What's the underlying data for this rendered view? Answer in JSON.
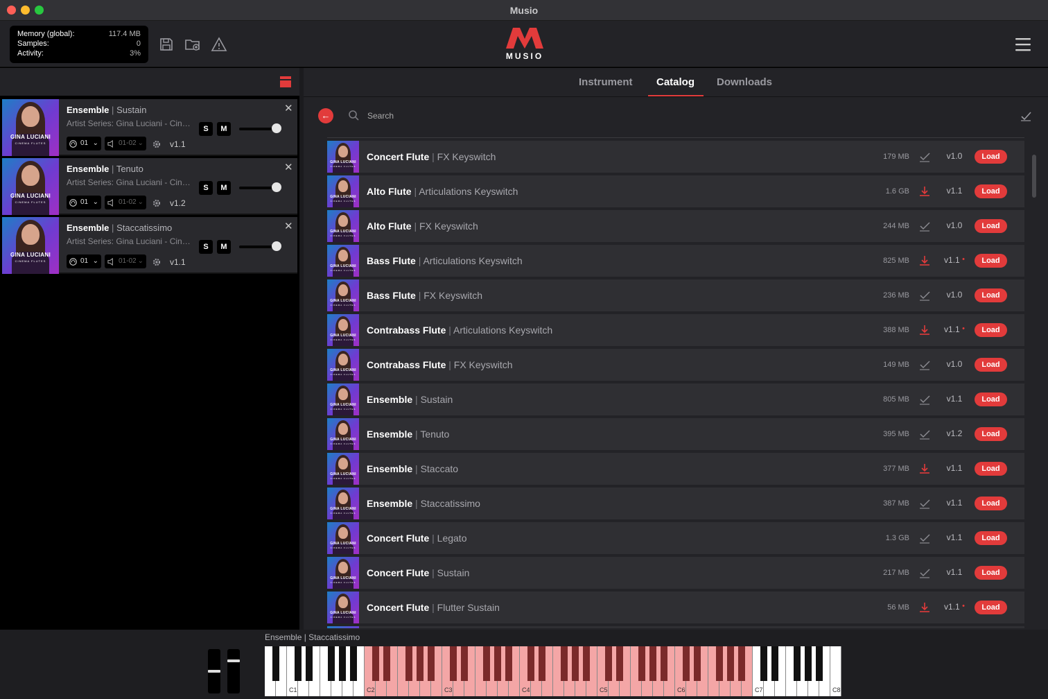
{
  "window": {
    "title": "Musio"
  },
  "stats": [
    {
      "label": "Memory (global):",
      "value": "117.4 MB"
    },
    {
      "label": "Samples:",
      "value": "0"
    },
    {
      "label": "Activity:",
      "value": "3%"
    }
  ],
  "brand": {
    "logo_text": "MUSIO",
    "accent": "#e23b3b"
  },
  "tabs": [
    {
      "label": "Instrument"
    },
    {
      "label": "Catalog"
    },
    {
      "label": "Downloads"
    }
  ],
  "active_tab": "Catalog",
  "search": {
    "placeholder": "Search"
  },
  "slots": [
    {
      "name": "Ensemble",
      "articulation": "Sustain",
      "artist": "Artist Series: Gina Luciani - Cinema Flutes",
      "channel": "01",
      "output": "01-02",
      "version": "v1.1",
      "volume": 0.9,
      "thumb_brand": "GINA LUCIANI",
      "thumb_sub": "CINEMA FLUTES"
    },
    {
      "name": "Ensemble",
      "articulation": "Tenuto",
      "artist": "Artist Series: Gina Luciani - Cinema Flutes",
      "channel": "01",
      "output": "01-02",
      "version": "v1.2",
      "volume": 0.9,
      "thumb_brand": "GINA LUCIANI",
      "thumb_sub": "CINEMA FLUTES"
    },
    {
      "name": "Ensemble",
      "articulation": "Staccatissimo",
      "artist": "Artist Series: Gina Luciani - Cinema Flutes",
      "channel": "01",
      "output": "01-02",
      "version": "v1.1",
      "volume": 0.9,
      "thumb_brand": "GINA LUCIANI",
      "thumb_sub": "CINEMA FLUTES"
    }
  ],
  "slot_buttons": {
    "solo": "S",
    "mute": "M"
  },
  "catalog": [
    {
      "name": "Concert Flute",
      "articulation": "FX Keyswitch",
      "size": "179 MB",
      "status": "installed",
      "version": "v1.0",
      "update": false
    },
    {
      "name": "Alto Flute",
      "articulation": "Articulations Keyswitch",
      "size": "1.6 GB",
      "status": "download",
      "version": "v1.1",
      "update": false
    },
    {
      "name": "Alto Flute",
      "articulation": "FX Keyswitch",
      "size": "244 MB",
      "status": "installed",
      "version": "v1.0",
      "update": false
    },
    {
      "name": "Bass Flute",
      "articulation": "Articulations Keyswitch",
      "size": "825 MB",
      "status": "download",
      "version": "v1.1",
      "update": true
    },
    {
      "name": "Bass Flute",
      "articulation": "FX Keyswitch",
      "size": "236 MB",
      "status": "installed",
      "version": "v1.0",
      "update": false
    },
    {
      "name": "Contrabass Flute",
      "articulation": "Articulations Keyswitch",
      "size": "388 MB",
      "status": "download",
      "version": "v1.1",
      "update": true
    },
    {
      "name": "Contrabass Flute",
      "articulation": "FX Keyswitch",
      "size": "149 MB",
      "status": "installed",
      "version": "v1.0",
      "update": false
    },
    {
      "name": "Ensemble",
      "articulation": "Sustain",
      "size": "805 MB",
      "status": "installed",
      "version": "v1.1",
      "update": false
    },
    {
      "name": "Ensemble",
      "articulation": "Tenuto",
      "size": "395 MB",
      "status": "installed",
      "version": "v1.2",
      "update": false
    },
    {
      "name": "Ensemble",
      "articulation": "Staccato",
      "size": "377 MB",
      "status": "download",
      "version": "v1.1",
      "update": false
    },
    {
      "name": "Ensemble",
      "articulation": "Staccatissimo",
      "size": "387 MB",
      "status": "installed",
      "version": "v1.1",
      "update": false
    },
    {
      "name": "Concert Flute",
      "articulation": "Legato",
      "size": "1.3 GB",
      "status": "installed",
      "version": "v1.1",
      "update": false
    },
    {
      "name": "Concert Flute",
      "articulation": "Sustain",
      "size": "217 MB",
      "status": "installed",
      "version": "v1.1",
      "update": false
    },
    {
      "name": "Concert Flute",
      "articulation": "Flutter Sustain",
      "size": "56 MB",
      "status": "download",
      "version": "v1.1",
      "update": true
    }
  ],
  "catalog_labels": {
    "load": "Load",
    "separator": "|",
    "update_marker": "•"
  },
  "keyboard": {
    "title": "Ensemble | Staccatissimo",
    "octave_labels": [
      "C1",
      "C2",
      "C3",
      "C4",
      "C5",
      "C6",
      "C7",
      "C8"
    ],
    "range_highlight": {
      "from": "C2",
      "to": "C7",
      "color": "#f4a6a6"
    },
    "pitch_wheel": 0.5,
    "mod_wheel": 0.75
  }
}
